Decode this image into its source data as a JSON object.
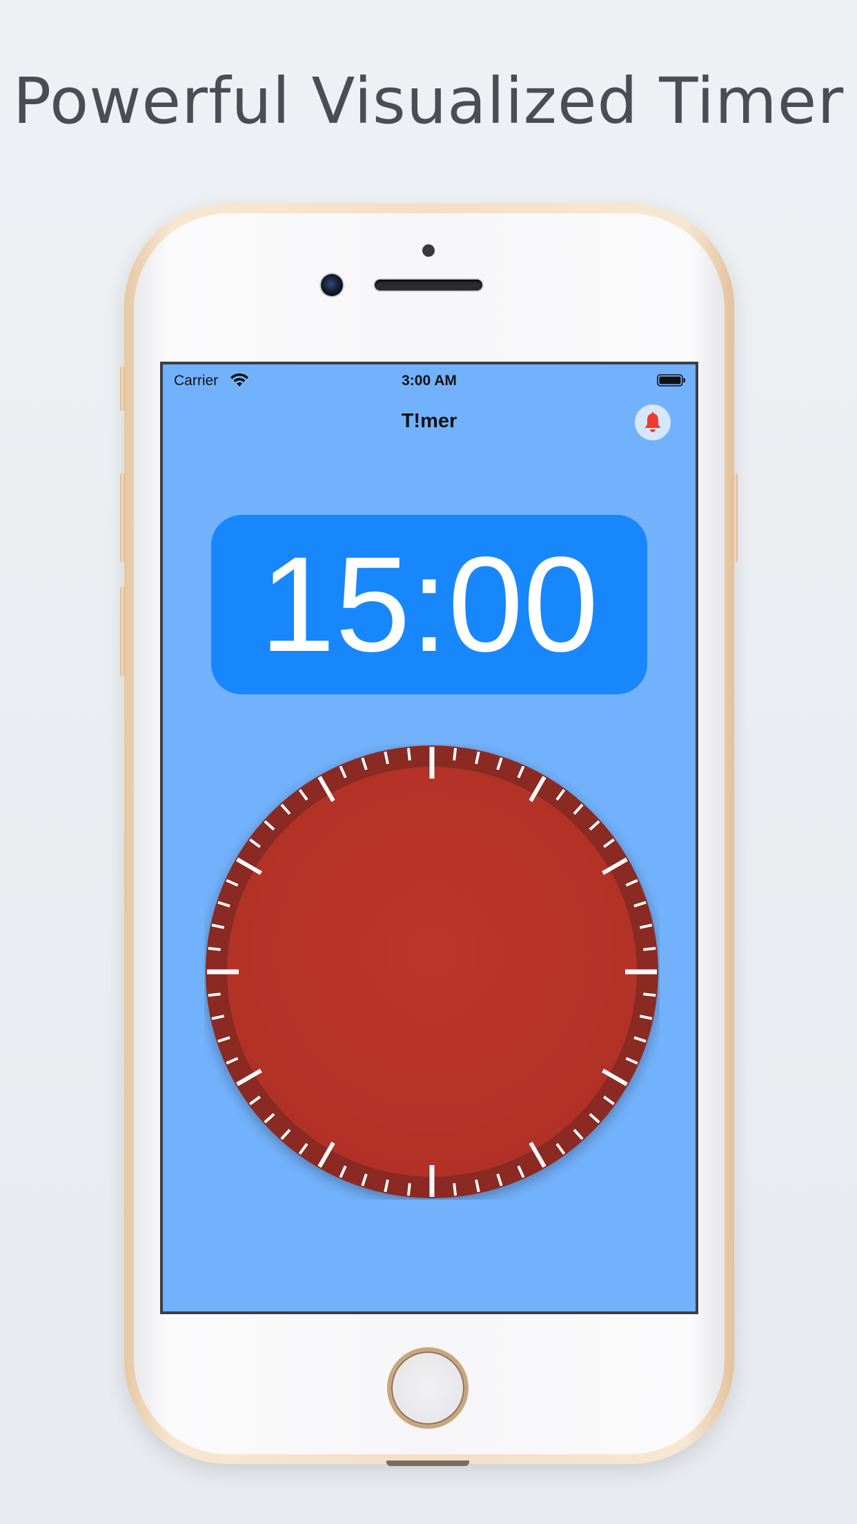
{
  "headline": "Powerful Visualized Timer",
  "status_bar": {
    "carrier": "Carrier",
    "time": "3:00 AM",
    "wifi_icon": "wifi-icon",
    "battery_icon": "battery-icon"
  },
  "nav": {
    "title": "T!mer",
    "alarm_icon": "bell-icon"
  },
  "timer": {
    "display": "15:00"
  },
  "dial": {
    "tick_count": 60,
    "face_color": "#b93428",
    "ring_color": "#8a2b20",
    "tick_color": "#ffffff"
  },
  "colors": {
    "screen_bg": "#72b2fd",
    "time_box": "#1987fc",
    "bell": "#f03a2e"
  }
}
